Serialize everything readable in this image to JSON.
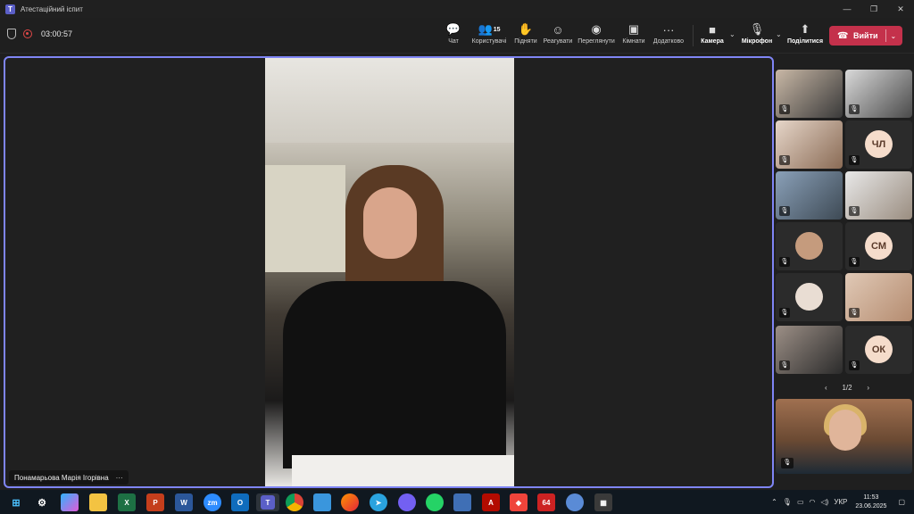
{
  "window": {
    "title": "Атестаційний іспит",
    "controls": [
      "—",
      "❐",
      "✕"
    ]
  },
  "toolbar": {
    "timer": "03:00:57",
    "buttons": [
      {
        "label": "Чат",
        "icon": "chat-icon",
        "glyph": "💬"
      },
      {
        "label": "Користувачі",
        "icon": "people-icon",
        "glyph": "👥",
        "count": "15"
      },
      {
        "label": "Підняти",
        "icon": "raise-hand-icon",
        "glyph": "✋"
      },
      {
        "label": "Реагувати",
        "icon": "react-icon",
        "glyph": "☺"
      },
      {
        "label": "Переглянути",
        "icon": "view-icon",
        "glyph": "◉"
      },
      {
        "label": "Кімнати",
        "icon": "rooms-icon",
        "glyph": "▣"
      },
      {
        "label": "Додатково",
        "icon": "more-icon",
        "glyph": "···"
      },
      {
        "label": "Камера",
        "icon": "camera-icon",
        "glyph": "■"
      },
      {
        "label": "Мікрофон",
        "icon": "mic-off-icon",
        "glyph": "🎙"
      },
      {
        "label": "Поділитися",
        "icon": "share-icon",
        "glyph": "⬆"
      }
    ],
    "leave_label": "Вийти"
  },
  "stage": {
    "speaker_name": "Понамарьова Марія Ігорівна",
    "more": "···"
  },
  "gallery": {
    "initials": [
      "ЧЛ",
      "СМ",
      "ОК"
    ],
    "pager": "1/2",
    "mic_glyph": "🎙"
  },
  "taskbar": {
    "language": "УКР",
    "time": "11:53",
    "date": "23.06.2025",
    "apps": [
      "start",
      "settings",
      "copilot",
      "explorer",
      "excel",
      "powerpoint",
      "word",
      "zoom",
      "outlook",
      "teams",
      "chrome",
      "photos",
      "firefox",
      "telegram",
      "viber",
      "whatsapp",
      "save",
      "acrobat",
      "anydesk",
      "app-64",
      "paint",
      "calculator"
    ],
    "badge_64": "64"
  },
  "colors": {
    "accent": "#7f85f5",
    "leave": "#c4314b",
    "background": "#1f1f1f"
  }
}
